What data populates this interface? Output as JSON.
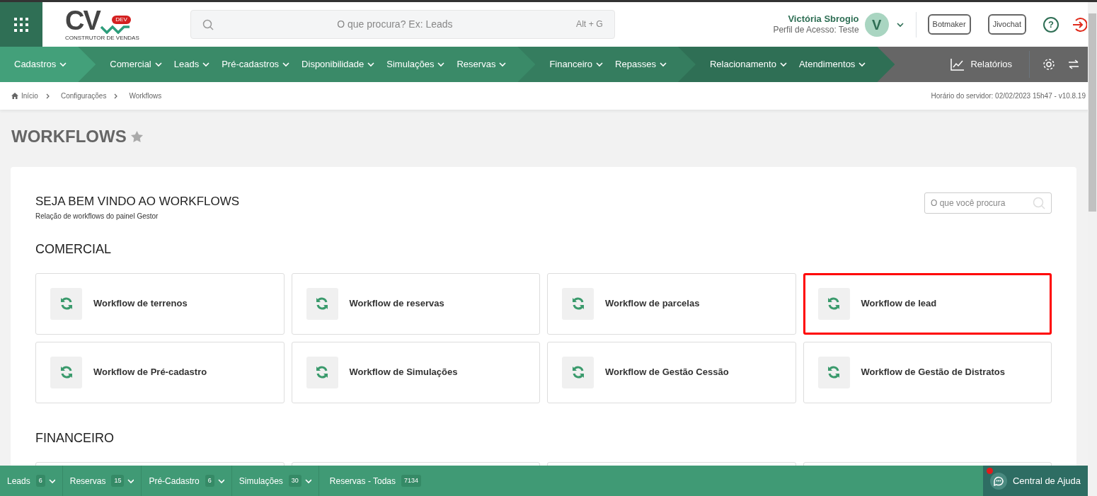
{
  "header": {
    "logo": {
      "letters": "CV",
      "badge": "DEV",
      "tagline": "CONSTRUTOR DE VENDAS"
    },
    "search": {
      "placeholder": "O que procura? Ex: Leads",
      "shortcut": "Alt + G"
    },
    "user": {
      "name": "Victória Sbrogio",
      "profile": "Perfil de Acesso: Teste",
      "initial": "V"
    },
    "buttons": [
      "Botmaker",
      "Jivochat"
    ],
    "help_symbol": "?"
  },
  "nav": {
    "groups": [
      {
        "color": "#43a07a",
        "items": [
          "Cadastros"
        ]
      },
      {
        "color": "#3a8a68",
        "items": [
          "Comercial",
          "Leads",
          "Pré-cadastros",
          "Disponibilidade",
          "Simulações",
          "Reservas"
        ]
      },
      {
        "color": "#357d5f",
        "items": [
          "Financeiro",
          "Repasses"
        ]
      },
      {
        "color": "#2f6f55",
        "items": [
          "Relacionamento",
          "Atendimentos"
        ]
      }
    ],
    "reports": "Relatórios"
  },
  "breadcrumb": {
    "items": [
      "Início",
      "Configurações",
      "Workflows"
    ],
    "server_time": "Horário do servidor: 02/02/2023 15h47 - v10.8.19"
  },
  "page_title": "WORKFLOWS",
  "panel": {
    "title": "SEJA BEM VINDO AO WORKFLOWS",
    "subtitle": "Relação de workflows do painel Gestor",
    "search": {
      "placeholder": "O que você procura"
    },
    "sections": [
      {
        "title": "COMERCIAL",
        "cards": [
          {
            "label": "Workflow de terrenos",
            "highlighted": false
          },
          {
            "label": "Workflow de reservas",
            "highlighted": false
          },
          {
            "label": "Workflow de parcelas",
            "highlighted": false
          },
          {
            "label": "Workflow de lead",
            "highlighted": true
          },
          {
            "label": "Workflow de Pré-cadastro",
            "highlighted": false
          },
          {
            "label": "Workflow de Simulações",
            "highlighted": false
          },
          {
            "label": "Workflow de Gestão Cessão",
            "highlighted": false
          },
          {
            "label": "Workflow de Gestão de Distratos",
            "highlighted": false
          }
        ]
      },
      {
        "title": "FINANCEIRO"
      }
    ]
  },
  "bottom_bar": {
    "tabs": [
      {
        "label": "Leads",
        "count": "6",
        "dropdown": true
      },
      {
        "label": "Reservas",
        "count": "15",
        "dropdown": true
      },
      {
        "label": "Pré-Cadastro",
        "count": "6",
        "dropdown": true
      },
      {
        "label": "Simulações",
        "count": "30",
        "dropdown": true
      },
      {
        "label": "Reservas - Todas",
        "count": "7134",
        "dropdown": false
      }
    ],
    "help": {
      "label": "Central de Ajuda",
      "notification": true
    }
  }
}
